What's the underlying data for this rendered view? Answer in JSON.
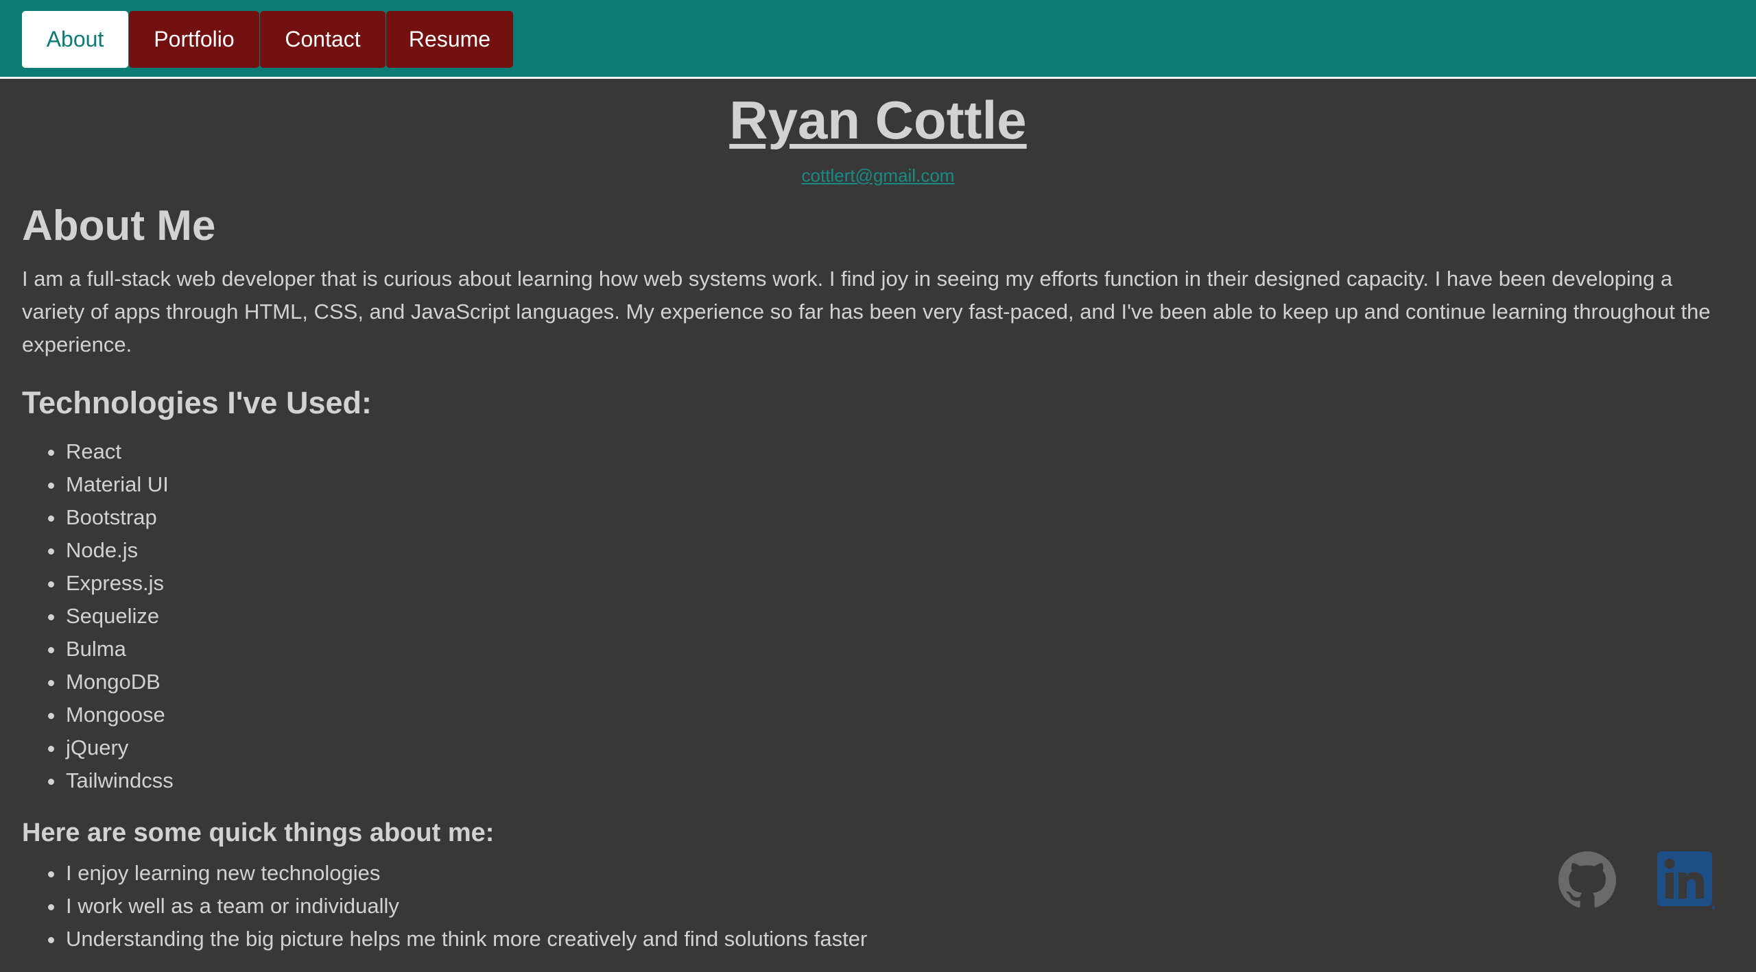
{
  "nav": {
    "tabs": [
      {
        "label": "About"
      },
      {
        "label": "Portfolio"
      },
      {
        "label": "Contact"
      },
      {
        "label": "Resume"
      }
    ],
    "active": "About"
  },
  "header": {
    "name": "Ryan Cottle",
    "email": "cottlert@gmail.com"
  },
  "about": {
    "title": "About Me",
    "text": "I am a full-stack web developer that is curious about learning how web systems work. I find joy in seeing my efforts function in their designed capacity. I have been developing a variety of apps through HTML, CSS, and JavaScript languages. My experience so far has been very fast-paced, and I've been able to keep up and continue learning throughout the experience."
  },
  "tech": {
    "title": "Technologies I've Used:",
    "items": [
      "React",
      "Material UI",
      "Bootstrap",
      "Node.js",
      "Express.js",
      "Sequelize",
      "Bulma",
      "MongoDB",
      "Mongoose",
      "jQuery",
      "Tailwindcss"
    ]
  },
  "quick": {
    "title": "Here are some quick things about me:",
    "items": [
      "I enjoy learning new technologies",
      "I work well as a team or individually",
      "Understanding the big picture helps me think more creatively and find solutions faster"
    ]
  },
  "social": {
    "github_icon": "github-icon",
    "linkedin_icon": "linkedin-icon"
  },
  "colors": {
    "nav_bg": "#0b7b76",
    "tab_bg": "#731010",
    "page_bg": "#383838",
    "text": "#d2d2d2",
    "link": "#1a8a84",
    "linkedin": "#1d4e86"
  }
}
